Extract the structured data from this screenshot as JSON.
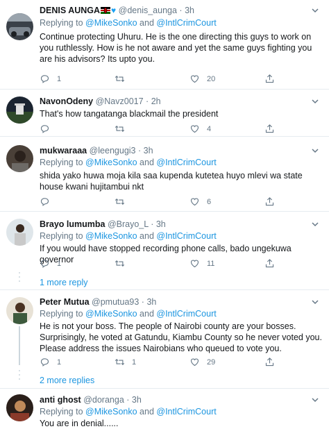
{
  "colors": {
    "link": "#1b95e0",
    "muted": "#657786",
    "separator": "#e6ecf0"
  },
  "tweets": [
    {
      "name": "DENIS AUNGA",
      "emoji": "kenya-flag, blue-heart",
      "handle": "@denis_aunga",
      "time": "3h",
      "reply_prefix": "Replying to",
      "mention1": "@MikeSonko",
      "and": "and",
      "mention2": "@IntlCrimCourt",
      "text": "Continue protecting Uhuru. He is the one directing this guys to work on you ruthlessly. How is he not aware and yet the same guys fighting you are his advisors? Its upto you.",
      "replies": "1",
      "retweets": "",
      "likes": "20"
    },
    {
      "name": "NavonOdeny",
      "handle": "@Navz0017",
      "time": "2h",
      "text": "That's how tangatanga blackmail the president",
      "replies": "",
      "retweets": "",
      "likes": "4"
    },
    {
      "name": "mukwaraaa",
      "handle": "@leengugi3",
      "time": "3h",
      "reply_prefix": "Replying to",
      "mention1": "@MikeSonko",
      "and": "and",
      "mention2": "@IntlCrimCourt",
      "text": "shida yako huwa moja kila saa kupenda kutetea huyo mlevi wa state house kwani hujitambui nkt",
      "replies": "",
      "retweets": "",
      "likes": "6"
    },
    {
      "name": "Brayo lumumba",
      "handle": "@Brayo_L",
      "time": "3h",
      "reply_prefix": "Replying to",
      "mention1": "@MikeSonko",
      "and": "and",
      "mention2": "@IntlCrimCourt",
      "text": "If you would have stopped recording phone calls, bado ungekuwa governor",
      "replies": "1",
      "retweets": "",
      "likes": "11",
      "more": "1 more reply"
    },
    {
      "name": "Peter Mutua",
      "handle": "@pmutua93",
      "time": "3h",
      "reply_prefix": "Replying to",
      "mention1": "@MikeSonko",
      "and": "and",
      "mention2": "@IntlCrimCourt",
      "text": "He is not your boss. The people of Nairobi county are your bosses. Surprisingly, he voted at Gatundu, Kiambu County so he never voted you. Please address the issues Nairobians who queued to vote you.",
      "replies": "1",
      "retweets": "1",
      "likes": "29",
      "more": "2 more replies"
    },
    {
      "name": "anti ghost",
      "handle": "@doranga",
      "time": "3h",
      "reply_prefix": "Replying to",
      "mention1": "@MikeSonko",
      "and": "and",
      "mention2": "@IntlCrimCourt",
      "text": "You are in denial......"
    }
  ]
}
